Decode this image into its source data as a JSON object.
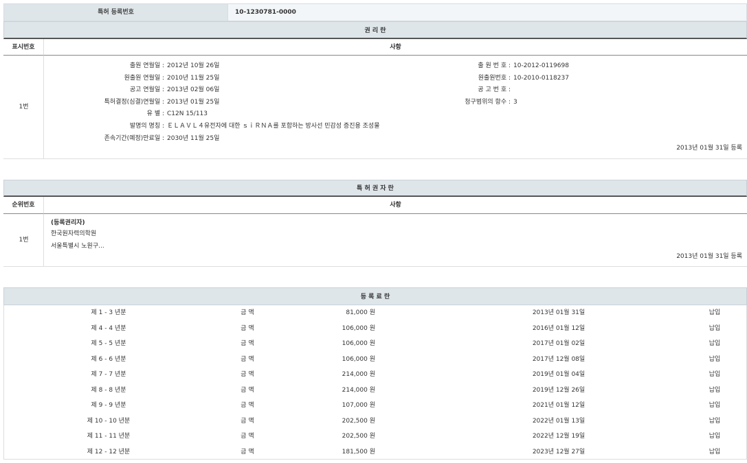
{
  "header": {
    "reg_label": "특허 등록번호",
    "reg_value": "10-1230781-0000"
  },
  "rights_section": {
    "title": "권 리 란",
    "col_no": "표시번호",
    "col_matter": "사항",
    "row_no": "1번",
    "left_fields": [
      {
        "label": "출원 연월일 :",
        "value": "2012년 10월 26일"
      },
      {
        "label": "원출원 연월일 :",
        "value": "2010년 11월 25일"
      },
      {
        "label": "공고 연월일 :",
        "value": "2013년 02월 06일"
      },
      {
        "label": "특허결정(심결)연월일 :",
        "value": "2013년 01월 25일"
      },
      {
        "label": "유 별 :",
        "value": "C12N 15/113"
      },
      {
        "label": "발명의 명칭 :",
        "value": "ＥＬＡＶＬ４유전자에 대한 ｓｉＲＮＡ를 포함하는 방사선 민감성 증진용 조성물"
      },
      {
        "label": "존속기간(예정)만료일 :",
        "value": "2030년 11월 25일"
      }
    ],
    "right_fields": [
      {
        "label": "출 원 번 호 :",
        "value": "10-2012-0119698"
      },
      {
        "label": "원출원번호 :",
        "value": "10-2010-0118237"
      },
      {
        "label": "공 고 번 호 :",
        "value": ""
      },
      {
        "label": "청구범위의 항수 :",
        "value": "3"
      }
    ],
    "reg_date": "2013년 01월 31일 등록"
  },
  "holder_section": {
    "title": "특 허 권 자 란",
    "col_no": "순위번호",
    "col_matter": "사항",
    "row_no": "1번",
    "holder_type": "(등록권리자)",
    "holder_name": "한국원자력의학원",
    "holder_addr": "서울특별시 노원구...",
    "reg_date": "2013년 01월 31일 등록"
  },
  "fee_section": {
    "title": "등 록 료 란",
    "rows": [
      {
        "period": "제 1 - 3 년분",
        "label": "금 액",
        "amount": "81,000 원",
        "date": "2013년 01월 31일",
        "status": "납입"
      },
      {
        "period": "제 4 - 4 년분",
        "label": "금 액",
        "amount": "106,000 원",
        "date": "2016년 01월 12일",
        "status": "납입"
      },
      {
        "period": "제 5 - 5 년분",
        "label": "금 액",
        "amount": "106,000 원",
        "date": "2017년 01월 02일",
        "status": "납입"
      },
      {
        "period": "제 6 - 6 년분",
        "label": "금 액",
        "amount": "106,000 원",
        "date": "2017년 12월 08일",
        "status": "납입"
      },
      {
        "period": "제 7 - 7 년분",
        "label": "금 액",
        "amount": "214,000 원",
        "date": "2019년 01월 04일",
        "status": "납입"
      },
      {
        "period": "제 8 - 8 년분",
        "label": "금 액",
        "amount": "214,000 원",
        "date": "2019년 12월 26일",
        "status": "납입"
      },
      {
        "period": "제 9 - 9 년분",
        "label": "금 액",
        "amount": "107,000 원",
        "date": "2021년 01월 12일",
        "status": "납입"
      },
      {
        "period": "제 10 - 10 년분",
        "label": "금 액",
        "amount": "202,500 원",
        "date": "2022년 01월 13일",
        "status": "납입"
      },
      {
        "period": "제 11 - 11 년분",
        "label": "금 액",
        "amount": "202,500 원",
        "date": "2022년 12월 19일",
        "status": "납입"
      },
      {
        "period": "제 12 - 12 년분",
        "label": "금 액",
        "amount": "181,500 원",
        "date": "2023년 12월 27일",
        "status": "납입"
      }
    ]
  }
}
